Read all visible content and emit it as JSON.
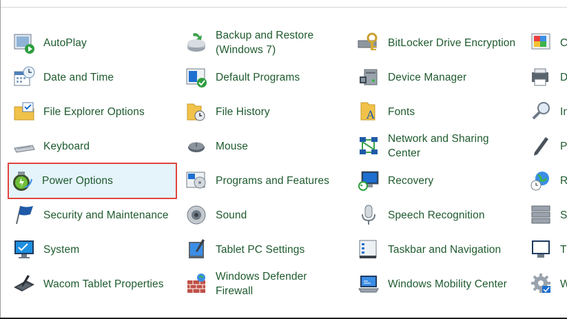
{
  "control_panel": {
    "items": [
      {
        "label": "AutoPlay",
        "icon": "autoplay-icon"
      },
      {
        "label": "Backup and Restore\n(Windows 7)",
        "icon": "backup-restore-icon"
      },
      {
        "label": "BitLocker Drive Encryption",
        "icon": "bitlocker-icon"
      },
      {
        "label": "C",
        "icon": "color-management-icon"
      },
      {
        "label": "Date and Time",
        "icon": "calendar-clock-icon"
      },
      {
        "label": "Default Programs",
        "icon": "default-programs-icon"
      },
      {
        "label": "Device Manager",
        "icon": "device-manager-icon"
      },
      {
        "label": "D",
        "icon": "devices-printers-icon"
      },
      {
        "label": "File Explorer Options",
        "icon": "folder-options-icon"
      },
      {
        "label": "File History",
        "icon": "file-history-icon"
      },
      {
        "label": "Fonts",
        "icon": "fonts-icon"
      },
      {
        "label": "In",
        "icon": "indexing-options-icon"
      },
      {
        "label": "Keyboard",
        "icon": "keyboard-icon"
      },
      {
        "label": "Mouse",
        "icon": "mouse-icon"
      },
      {
        "label": "Network and Sharing\nCenter",
        "icon": "network-icon"
      },
      {
        "label": "Pe",
        "icon": "pen-icon"
      },
      {
        "label": "Power Options",
        "icon": "battery-icon"
      },
      {
        "label": "Programs and Features",
        "icon": "programs-features-icon"
      },
      {
        "label": "Recovery",
        "icon": "recovery-icon"
      },
      {
        "label": "R",
        "icon": "region-icon"
      },
      {
        "label": "Security and Maintenance",
        "icon": "flag-icon"
      },
      {
        "label": "Sound",
        "icon": "speaker-icon"
      },
      {
        "label": "Speech Recognition",
        "icon": "microphone-icon"
      },
      {
        "label": "S",
        "icon": "storage-spaces-icon"
      },
      {
        "label": "System",
        "icon": "system-monitor-icon"
      },
      {
        "label": "Tablet PC Settings",
        "icon": "tablet-pc-icon"
      },
      {
        "label": "Taskbar and Navigation",
        "icon": "taskbar-icon"
      },
      {
        "label": "Tr",
        "icon": "troubleshooting-icon"
      },
      {
        "label": "Wacom Tablet Properties",
        "icon": "wacom-tablet-icon"
      },
      {
        "label": "Windows Defender\nFirewall",
        "icon": "firewall-icon"
      },
      {
        "label": "Windows Mobility Center",
        "icon": "mobility-center-icon"
      },
      {
        "label": "W",
        "icon": "gear-icon"
      }
    ],
    "selected_index": 16,
    "colors": {
      "link_text": "#1e5a2e",
      "selection_background": "#e5f3fb",
      "selection_border": "#e0443e"
    }
  }
}
